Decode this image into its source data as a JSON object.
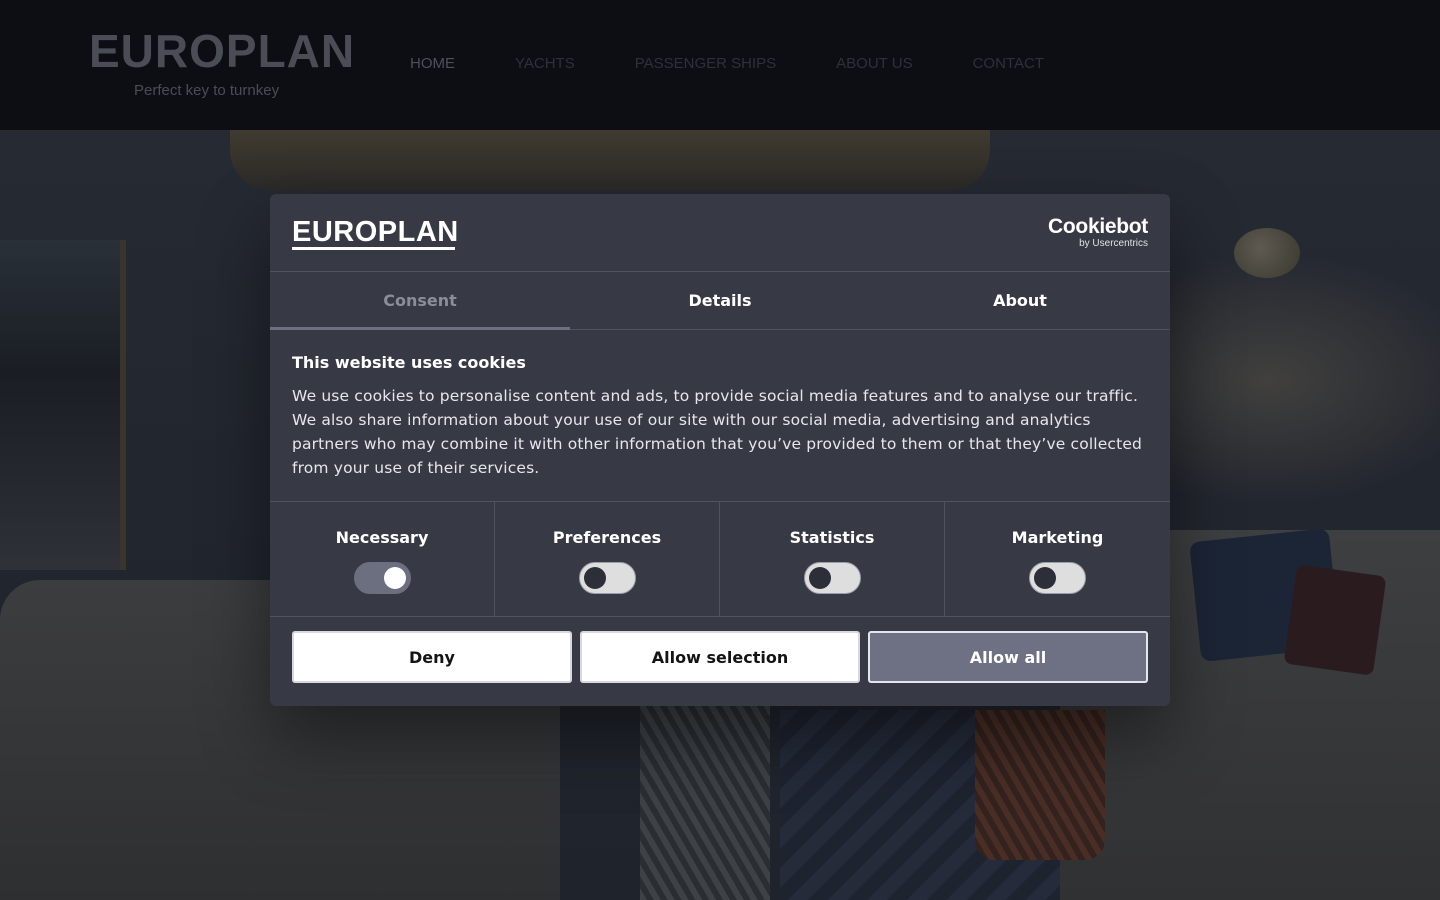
{
  "site": {
    "brand": {
      "name": "EUROPLAN",
      "tagline": "Perfect key to turnkey"
    },
    "nav": [
      {
        "label": "HOME"
      },
      {
        "label": "YACHTS"
      },
      {
        "label": "PASSENGER SHIPS"
      },
      {
        "label": "ABOUT US"
      },
      {
        "label": "CONTACT"
      }
    ]
  },
  "cookie_dialog": {
    "logo": "EUROPLAN",
    "provider": {
      "name": "Cookiebot",
      "byline": "by Usercentrics"
    },
    "tabs": [
      {
        "label": "Consent",
        "active": true
      },
      {
        "label": "Details",
        "active": false
      },
      {
        "label": "About",
        "active": false
      }
    ],
    "title": "This website uses cookies",
    "text": "We use cookies to personalise content and ads, to provide social media features and to analyse our traffic. We also share information about your use of our site with our social media, advertising and analytics partners who may combine it with other information that you’ve provided to them or that they’ve collected from your use of their services.",
    "categories": [
      {
        "label": "Necessary",
        "checked": true,
        "disabled": true
      },
      {
        "label": "Preferences",
        "checked": false
      },
      {
        "label": "Statistics",
        "checked": false
      },
      {
        "label": "Marketing",
        "checked": false
      }
    ],
    "buttons": {
      "deny": "Deny",
      "allow_selection": "Allow selection",
      "allow_all": "Allow all"
    }
  },
  "colors": {
    "dialog_bg": "#373a45",
    "header_bg": "#0c0e14",
    "allow_all_bg": "#6d7183",
    "toggle_on": "#6b6f80"
  }
}
